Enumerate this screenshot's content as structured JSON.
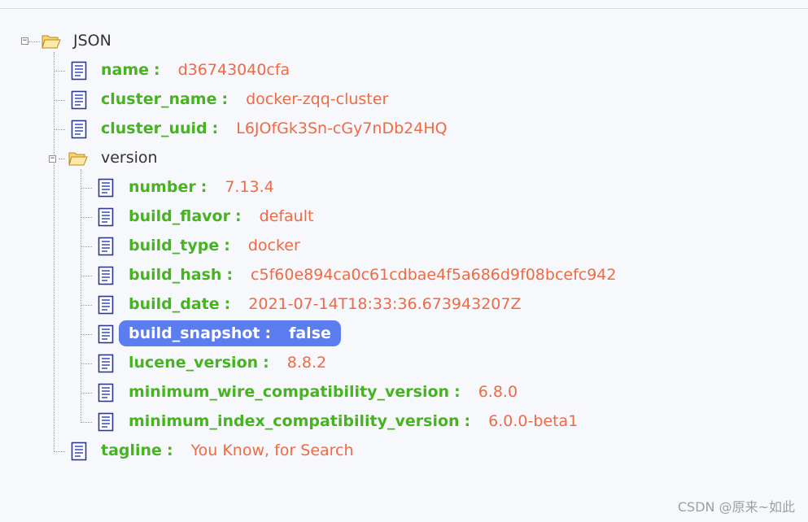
{
  "root": {
    "label": "JSON"
  },
  "fields": [
    {
      "key": "name",
      "value": "d36743040cfa"
    },
    {
      "key": "cluster_name",
      "value": "docker-zqq-cluster"
    },
    {
      "key": "cluster_uuid",
      "value": "L6JOfGk3Sn-cGy7nDb24HQ"
    }
  ],
  "version": {
    "label": "version",
    "fields": [
      {
        "key": "number",
        "value": "7.13.4"
      },
      {
        "key": "build_flavor",
        "value": "default"
      },
      {
        "key": "build_type",
        "value": "docker"
      },
      {
        "key": "build_hash",
        "value": "c5f60e894ca0c61cdbae4f5a686d9f08bcefc942"
      },
      {
        "key": "build_date",
        "value": "2021-07-14T18:33:36.673943207Z"
      },
      {
        "key": "build_snapshot",
        "value": "false"
      },
      {
        "key": "lucene_version",
        "value": "8.8.2"
      },
      {
        "key": "minimum_wire_compatibility_version",
        "value": "6.8.0"
      },
      {
        "key": "minimum_index_compatibility_version",
        "value": "6.0.0-beta1"
      }
    ]
  },
  "tagline": {
    "key": "tagline",
    "value": "You Know, for Search"
  },
  "colon": ":",
  "expand_symbol": "−",
  "watermark": "CSDN @原来~如此"
}
